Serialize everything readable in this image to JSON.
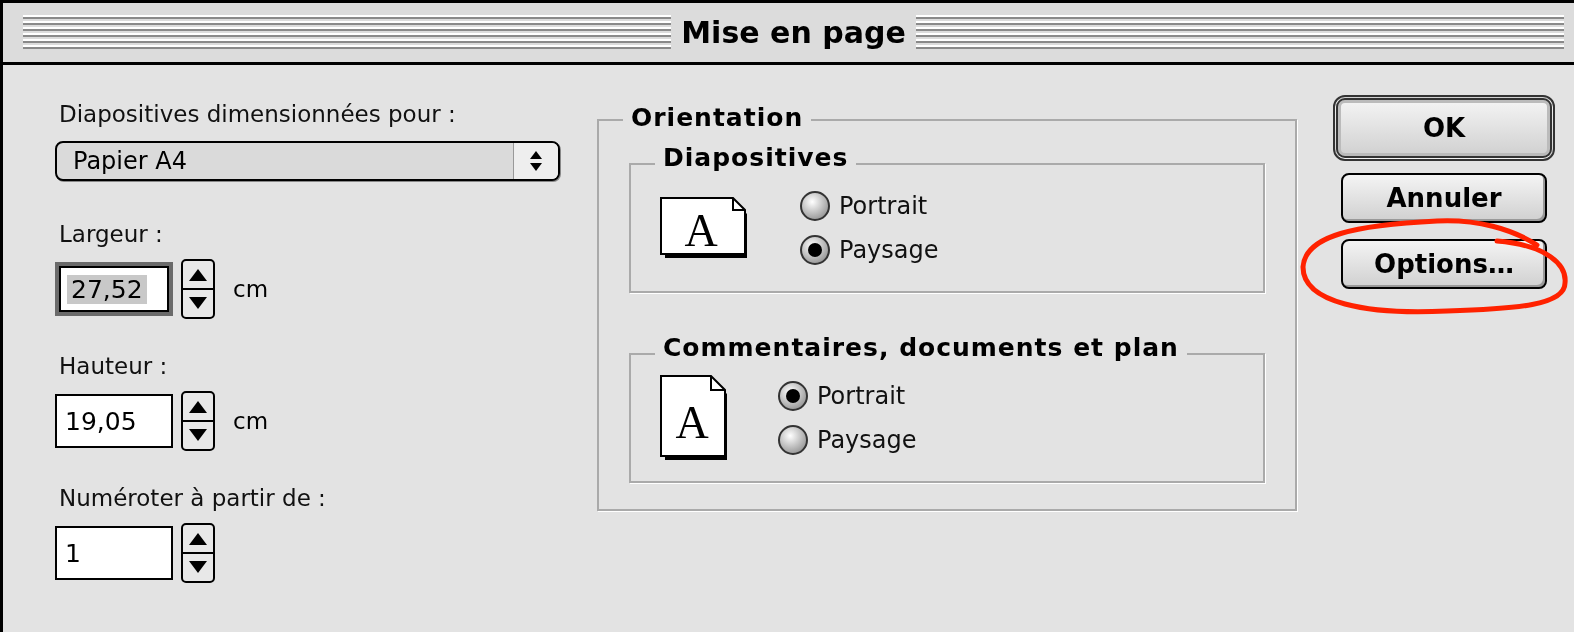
{
  "window": {
    "title": "Mise en page"
  },
  "slide_size": {
    "label": "Diapositives dimensionnées pour :",
    "value": "Papier A4"
  },
  "fields": [
    {
      "label": "Largeur :",
      "value": "27,52",
      "unit": "cm",
      "focused": true
    },
    {
      "label": "Hauteur :",
      "value": "19,05",
      "unit": "cm",
      "focused": false
    },
    {
      "label": "Numéroter à partir de :",
      "value": "1",
      "focused": false
    }
  ],
  "orientation": {
    "title": "Orientation",
    "groups": [
      {
        "title": "Diapositives",
        "kind": "landscape",
        "glyph": "A",
        "options": [
          {
            "label": "Portrait",
            "selected": false
          },
          {
            "label": "Paysage",
            "selected": true
          }
        ]
      },
      {
        "title": "Commentaires, documents et plan",
        "kind": "portrait",
        "glyph": "A",
        "options": [
          {
            "label": "Portrait",
            "selected": true
          },
          {
            "label": "Paysage",
            "selected": false
          }
        ]
      }
    ]
  },
  "buttons": [
    {
      "label": "OK",
      "default": true,
      "circled": false
    },
    {
      "label": "Annuler",
      "default": false,
      "circled": false
    },
    {
      "label": "Options…",
      "default": false,
      "circled": true
    }
  ]
}
